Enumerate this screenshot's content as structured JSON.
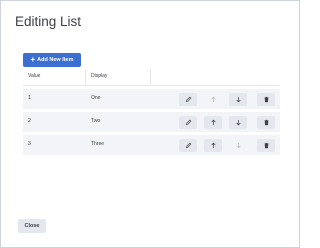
{
  "dialog": {
    "title": "Editing List",
    "add_button_label": "Add New Item",
    "close_button_label": "Close"
  },
  "table": {
    "columns": [
      "Value",
      "Display"
    ],
    "rows": [
      {
        "value": "1",
        "display": "One"
      },
      {
        "value": "2",
        "display": "Two"
      },
      {
        "value": "3",
        "display": "Three"
      }
    ]
  },
  "icons": {
    "add": "plus-icon",
    "edit": "pencil-icon",
    "move_up": "arrow-up-icon",
    "move_down": "arrow-down-icon",
    "delete": "trash-icon"
  },
  "colors": {
    "primary": "#3b6fd1",
    "row_background": "#f2f4f7",
    "button_background": "#e4e8ee",
    "text": "#3c3f44",
    "disabled_icon": "#b7bcc4"
  }
}
